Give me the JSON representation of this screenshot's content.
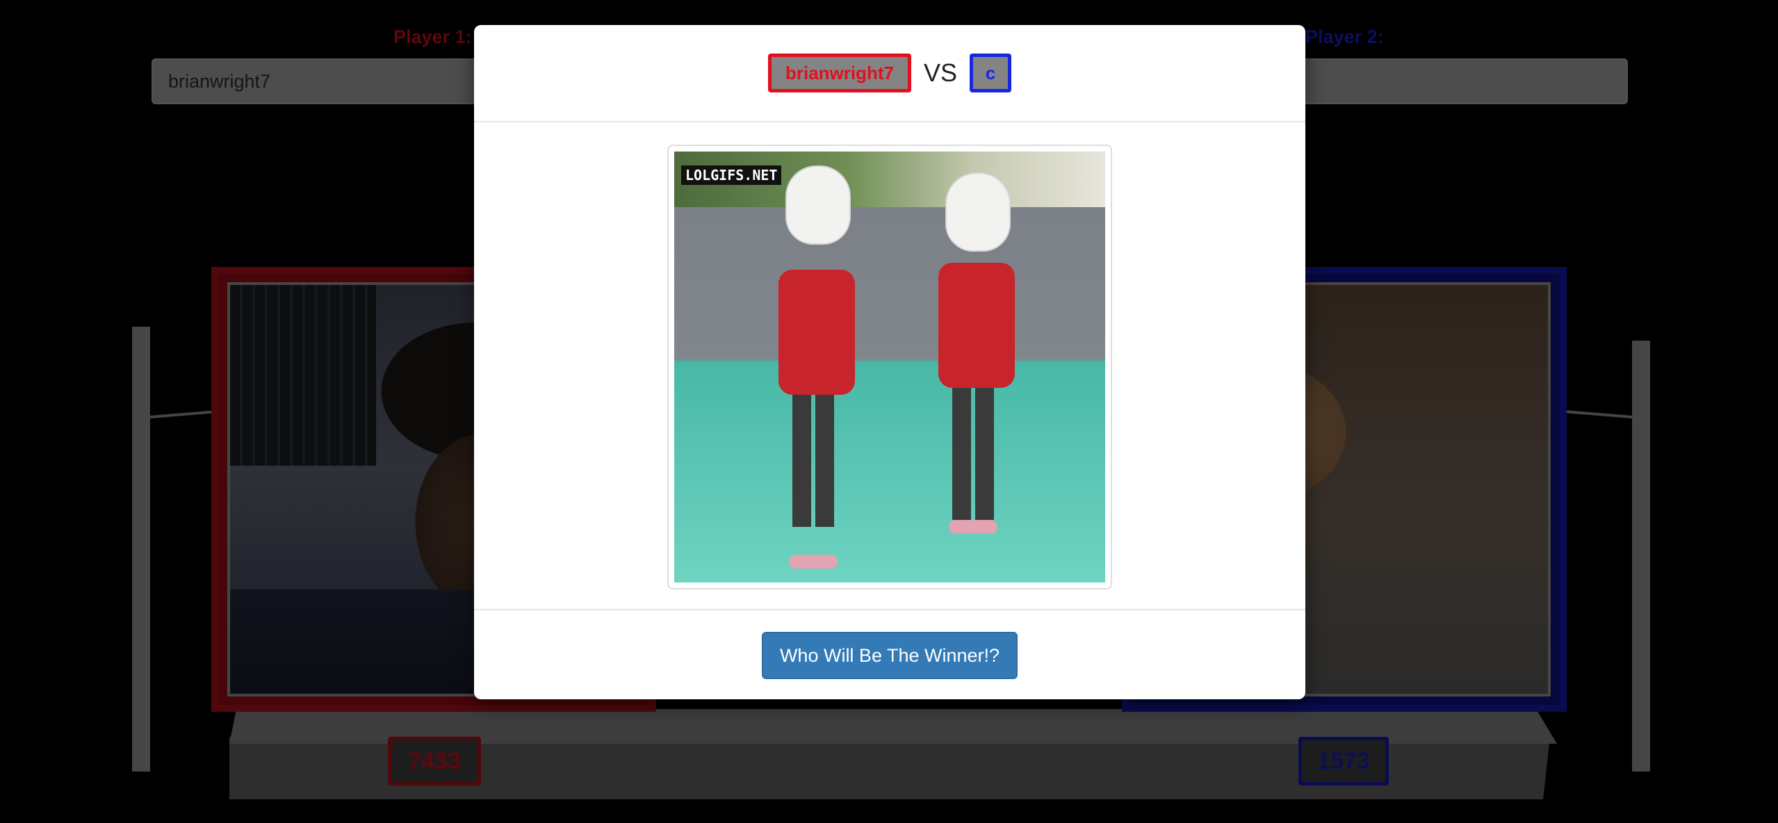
{
  "players": {
    "player1": {
      "label": "Player 1:",
      "name_value": "brianwright7",
      "score": "7433",
      "color": "#c00d1a"
    },
    "player2": {
      "label": "Player 2:",
      "name_value": "",
      "score": "1573",
      "color": "#1a1fc4"
    }
  },
  "modal": {
    "player1_badge": "brianwright7",
    "vs_text": "VS",
    "player2_badge": "c",
    "gif_watermark": "LOLGIFS.NET",
    "winner_button_label": "Who Will Be The Winner!?",
    "button_color": "#337ab7"
  }
}
